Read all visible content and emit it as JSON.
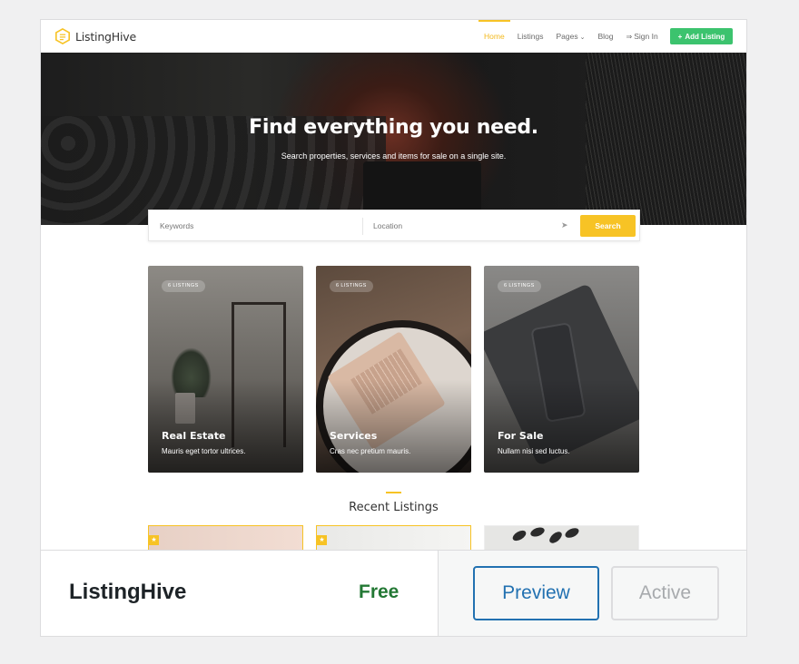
{
  "site": {
    "logo_text": "ListingHive",
    "nav": [
      "Home",
      "Listings",
      "Pages",
      "Blog",
      "Sign In"
    ],
    "add_listing": "Add Listing"
  },
  "hero": {
    "title": "Find everything you need.",
    "subtitle": "Search properties, services and items for sale on a single site."
  },
  "search": {
    "keywords_placeholder": "Keywords",
    "location_placeholder": "Location",
    "button": "Search"
  },
  "categories": [
    {
      "badge": "6 LISTINGS",
      "title": "Real Estate",
      "desc": "Mauris eget tortor ultrices."
    },
    {
      "badge": "6 LISTINGS",
      "title": "Services",
      "desc": "Cras nec pretium mauris."
    },
    {
      "badge": "6 LISTINGS",
      "title": "For Sale",
      "desc": "Nullam nisi sed luctus."
    }
  ],
  "recent_title": "Recent Listings",
  "theme": {
    "name": "ListingHive",
    "price": "Free",
    "preview_label": "Preview",
    "active_label": "Active"
  },
  "colors": {
    "accent": "#f7c325",
    "add_button": "#3cc36e",
    "free": "#237834",
    "preview": "#2271b1"
  }
}
